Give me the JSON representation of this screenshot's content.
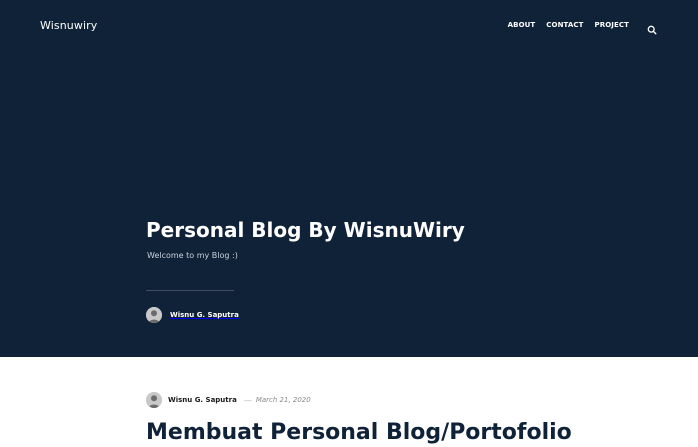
{
  "header": {
    "site_title": "Wisnuwiry",
    "nav": [
      {
        "label": "ABOUT"
      },
      {
        "label": "CONTACT"
      },
      {
        "label": "PROJECT"
      }
    ],
    "search_icon": "search-icon"
  },
  "hero": {
    "title": "Personal Blog By WisnuWiry",
    "subtitle": "Welcome to my Blog :)",
    "author": "Wisnu G. Saputra"
  },
  "post": {
    "author": "Wisnu G. Saputra",
    "separator": "—",
    "date": "March 21, 2020",
    "title": "Membuat Personal Blog/Portofolio"
  },
  "colors": {
    "hero_background": "#102238",
    "text_light": "#ffffff",
    "post_title": "#102238"
  }
}
